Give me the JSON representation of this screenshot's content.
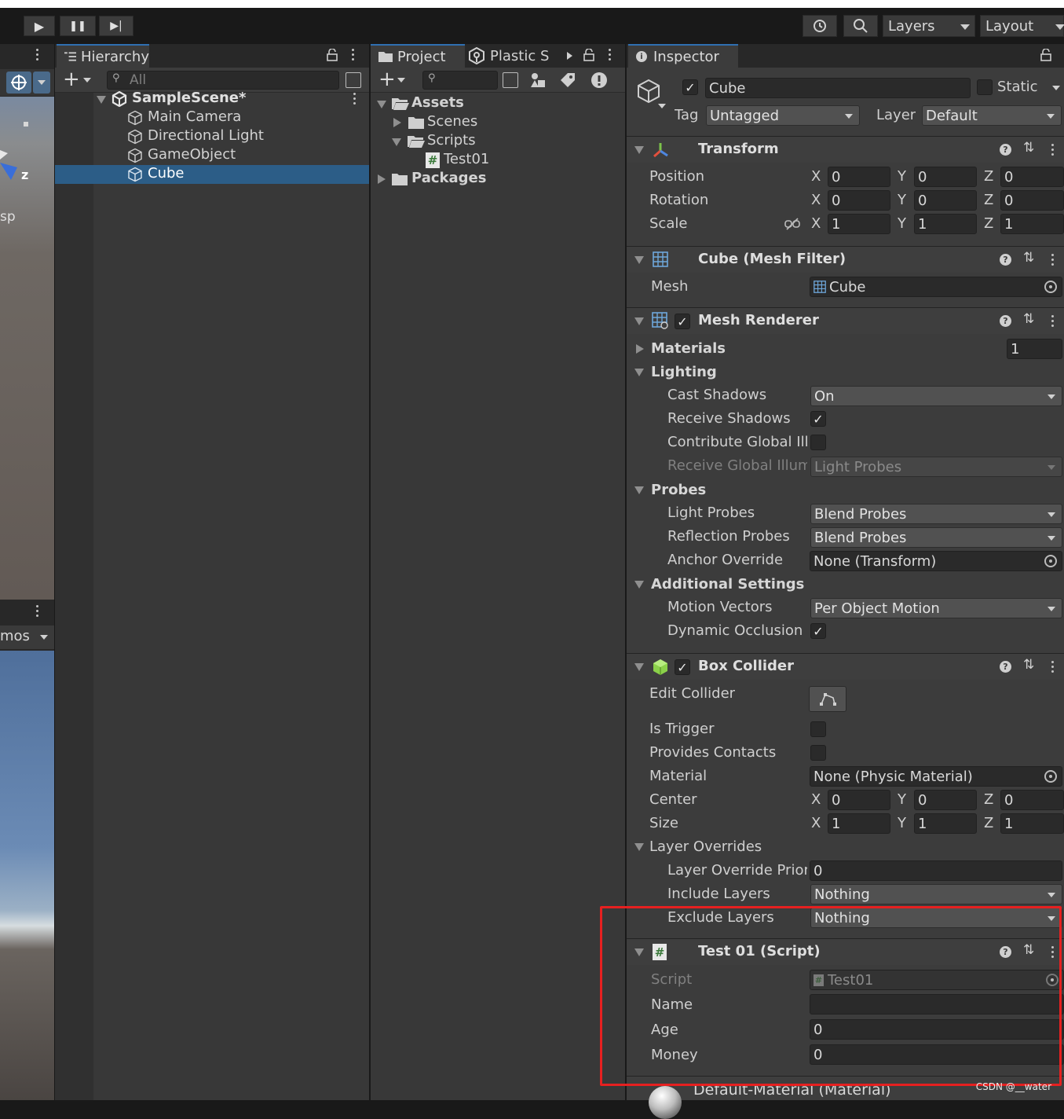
{
  "toolbar": {
    "layers_label": "Layers",
    "layout_label": "Layout",
    "play": "▶",
    "pause": "❚❚",
    "step": "▶|"
  },
  "scene": {
    "axis_label": "z",
    "persp_fragment": "sp",
    "gizmos_fragment": "mos"
  },
  "hierarchy": {
    "tab_label": "Hierarchy",
    "search_placeholder": "All",
    "scene_name": "SampleScene*",
    "items": [
      {
        "label": "Main Camera"
      },
      {
        "label": "Directional Light"
      },
      {
        "label": "GameObject"
      },
      {
        "label": "Cube"
      }
    ]
  },
  "project": {
    "tab_label": "Project",
    "plastic_label": "Plastic S",
    "tree": {
      "assets": "Assets",
      "scenes": "Scenes",
      "scripts": "Scripts",
      "test01": "Test01",
      "packages": "Packages"
    }
  },
  "inspector": {
    "tab_label": "Inspector",
    "object_name": "Cube",
    "static_label": "Static",
    "tag_label": "Tag",
    "tag_value": "Untagged",
    "layer_label": "Layer",
    "layer_value": "Default",
    "transform": {
      "title": "Transform",
      "position_label": "Position",
      "rotation_label": "Rotation",
      "scale_label": "Scale",
      "position": {
        "x": "0",
        "y": "0",
        "z": "0"
      },
      "rotation": {
        "x": "0",
        "y": "0",
        "z": "0"
      },
      "scale": {
        "x": "1",
        "y": "1",
        "z": "1"
      }
    },
    "axes": {
      "x": "X",
      "y": "Y",
      "z": "Z"
    },
    "mesh_filter": {
      "title": "Cube (Mesh Filter)",
      "mesh_label": "Mesh",
      "mesh_value": "Cube"
    },
    "mesh_renderer": {
      "title": "Mesh Renderer",
      "materials_label": "Materials",
      "materials_count": "1",
      "lighting_label": "Lighting",
      "cast_shadows_label": "Cast Shadows",
      "cast_shadows_value": "On",
      "receive_shadows_label": "Receive Shadows",
      "contribute_gi_label": "Contribute Global Illu",
      "receive_gi_label": "Receive Global Illum",
      "receive_gi_value": "Light Probes",
      "probes_label": "Probes",
      "light_probes_label": "Light Probes",
      "light_probes_value": "Blend Probes",
      "reflection_probes_label": "Reflection Probes",
      "reflection_probes_value": "Blend Probes",
      "anchor_override_label": "Anchor Override",
      "anchor_override_value": "None (Transform)",
      "additional_label": "Additional Settings",
      "motion_vectors_label": "Motion Vectors",
      "motion_vectors_value": "Per Object Motion",
      "dynamic_occlusion_label": "Dynamic Occlusion"
    },
    "box_collider": {
      "title": "Box Collider",
      "edit_collider_label": "Edit Collider",
      "is_trigger_label": "Is Trigger",
      "provides_contacts_label": "Provides Contacts",
      "material_label": "Material",
      "material_value": "None (Physic Material)",
      "center_label": "Center",
      "size_label": "Size",
      "center": {
        "x": "0",
        "y": "0",
        "z": "0"
      },
      "size": {
        "x": "1",
        "y": "1",
        "z": "1"
      },
      "layer_overrides_label": "Layer Overrides",
      "layer_override_priority_label": "Layer Override Priori",
      "layer_override_priority_value": "0",
      "include_layers_label": "Include Layers",
      "include_layers_value": "Nothing",
      "exclude_layers_label": "Exclude Layers",
      "exclude_layers_value": "Nothing"
    },
    "script_component": {
      "title": "Test 01 (Script)",
      "script_label": "Script",
      "script_value": "Test01",
      "name_label": "Name",
      "name_value": "",
      "age_label": "Age",
      "age_value": "0",
      "money_label": "Money",
      "money_value": "0"
    },
    "material_footer": "Default-Material (Material)"
  },
  "watermark": "CSDN @__water",
  "colors": {
    "highlight_box": "#e62020",
    "selection": "#2c5d87"
  }
}
